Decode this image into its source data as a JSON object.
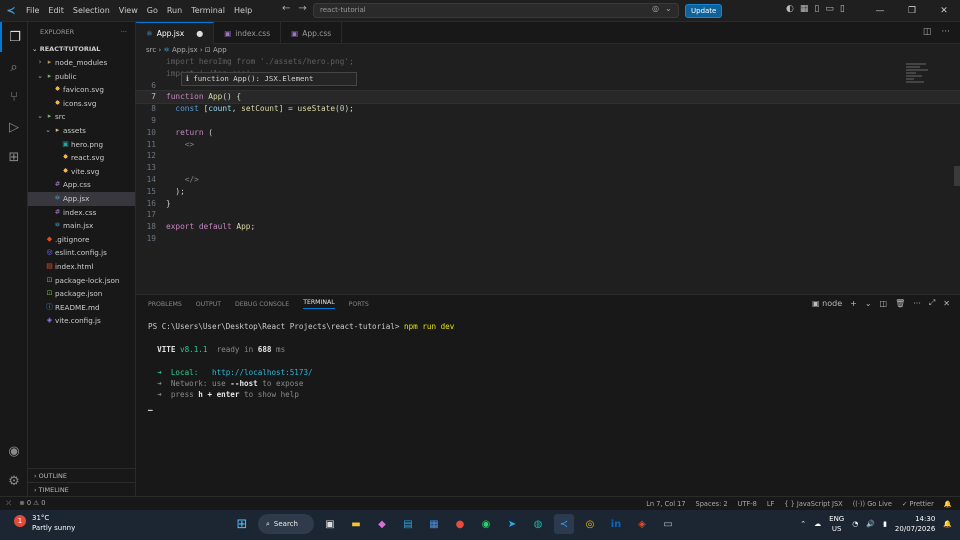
{
  "menu": [
    "File",
    "Edit",
    "Selection",
    "View",
    "Go",
    "Run",
    "Terminal",
    "Help"
  ],
  "search": {
    "text": "react-tutorial"
  },
  "update_label": "Update",
  "sidebar": {
    "header": "EXPLORER",
    "project": "REACT-TUTORIAL",
    "items": [
      {
        "label": "node_modules",
        "indent": 1,
        "chev": ">",
        "icon": "folder",
        "color": "#c09553"
      },
      {
        "label": "public",
        "indent": 1,
        "chev": "v",
        "icon": "folder",
        "color": "#7eb36a"
      },
      {
        "label": "favicon.svg",
        "indent": 2,
        "icon": "svg",
        "color": "#ffb13b"
      },
      {
        "label": "icons.svg",
        "indent": 2,
        "icon": "svg",
        "color": "#ffb13b"
      },
      {
        "label": "src",
        "indent": 1,
        "chev": "v",
        "icon": "folder",
        "color": "#7eb36a"
      },
      {
        "label": "assets",
        "indent": 2,
        "chev": "v",
        "icon": "folder",
        "color": "#dcb67a"
      },
      {
        "label": "hero.png",
        "indent": 3,
        "icon": "png",
        "color": "#26a69a"
      },
      {
        "label": "react.svg",
        "indent": 3,
        "icon": "svg",
        "color": "#ffb13b"
      },
      {
        "label": "vite.svg",
        "indent": 3,
        "icon": "svg",
        "color": "#ffb13b"
      },
      {
        "label": "App.css",
        "indent": 2,
        "icon": "css",
        "color": "#a074c4"
      },
      {
        "label": "App.jsx",
        "indent": 2,
        "icon": "react",
        "color": "#4fc1ff",
        "selected": true
      },
      {
        "label": "index.css",
        "indent": 2,
        "icon": "css",
        "color": "#a074c4"
      },
      {
        "label": "main.jsx",
        "indent": 2,
        "icon": "react",
        "color": "#4fc1ff"
      },
      {
        "label": ".gitignore",
        "indent": 1,
        "icon": "git",
        "color": "#e64a19"
      },
      {
        "label": "eslint.config.js",
        "indent": 1,
        "icon": "eslint",
        "color": "#7c6ff0"
      },
      {
        "label": "index.html",
        "indent": 1,
        "icon": "html",
        "color": "#e44d26"
      },
      {
        "label": "package-lock.json",
        "indent": 1,
        "icon": "npm",
        "color": "#7cb342"
      },
      {
        "label": "package.json",
        "indent": 1,
        "icon": "npm",
        "color": "#7cb342"
      },
      {
        "label": "README.md",
        "indent": 1,
        "icon": "md",
        "color": "#42a5f5"
      },
      {
        "label": "vite.config.js",
        "indent": 1,
        "icon": "vite",
        "color": "#9c7cf7"
      }
    ],
    "outline": "OUTLINE",
    "timeline": "TIMELINE"
  },
  "tabs": [
    {
      "label": "App.jsx",
      "icon_color": "#4fc1ff",
      "active": true,
      "modified": true
    },
    {
      "label": "index.css",
      "icon_color": "#a074c4"
    },
    {
      "label": "App.css",
      "icon_color": "#a074c4"
    }
  ],
  "breadcrumb": {
    "a": "src",
    "b": "App.jsx",
    "c": "App"
  },
  "hover_text": "function App(): JSX.Element",
  "code_lines": [
    {
      "n": "",
      "t": [
        [
          "plain",
          "import heroImg from './assets/hero.png';"
        ]
      ],
      "faded": true
    },
    {
      "n": "",
      "t": [
        [
          "plain",
          "import './App.css'"
        ]
      ],
      "faded": true
    },
    {
      "n": "6",
      "t": []
    },
    {
      "n": "7",
      "t": [
        [
          "kw",
          "function "
        ],
        [
          "fn",
          "App"
        ],
        [
          "plain",
          "() {"
        ]
      ],
      "current": true
    },
    {
      "n": "8",
      "t": [
        [
          "plain",
          "  "
        ],
        [
          "blue",
          "const "
        ],
        [
          "plain",
          "["
        ],
        [
          "var",
          "count"
        ],
        [
          "plain",
          ", "
        ],
        [
          "fn",
          "setCount"
        ],
        [
          "plain",
          "] = "
        ],
        [
          "fn",
          "useState"
        ],
        [
          "plain",
          "("
        ],
        [
          "num",
          "0"
        ],
        [
          "plain",
          ");"
        ]
      ]
    },
    {
      "n": "9",
      "t": []
    },
    {
      "n": "10",
      "t": [
        [
          "plain",
          "  "
        ],
        [
          "kw",
          "return "
        ],
        [
          "plain",
          "("
        ]
      ]
    },
    {
      "n": "11",
      "t": [
        [
          "plain",
          "    "
        ],
        [
          "dim",
          "<>"
        ]
      ]
    },
    {
      "n": "12",
      "t": []
    },
    {
      "n": "13",
      "t": []
    },
    {
      "n": "14",
      "t": [
        [
          "plain",
          "    "
        ],
        [
          "dim",
          "</>"
        ]
      ]
    },
    {
      "n": "15",
      "t": [
        [
          "plain",
          "  );"
        ]
      ]
    },
    {
      "n": "16",
      "t": [
        [
          "plain",
          "}"
        ]
      ]
    },
    {
      "n": "17",
      "t": []
    },
    {
      "n": "18",
      "t": [
        [
          "kw",
          "export default "
        ],
        [
          "fn",
          "App"
        ],
        [
          "plain",
          ";"
        ]
      ]
    },
    {
      "n": "19",
      "t": []
    }
  ],
  "panel": {
    "tabs": [
      "PROBLEMS",
      "OUTPUT",
      "DEBUG CONSOLE",
      "TERMINAL",
      "PORTS"
    ],
    "active": 3,
    "shell": "node"
  },
  "terminal": {
    "prompt": "PS C:\\Users\\User\\Desktop\\React Projects\\react-tutorial> ",
    "cmd": "npm run dev",
    "vite_name": "VITE",
    "vite_ver": " v8.1.1",
    "ready": "  ready in ",
    "ready_ms": "688",
    "ready_unit": " ms",
    "local_label": "  ➜  Local:   ",
    "local_url": "http://localhost:5173/",
    "net_label": "  ➜  Network: use ",
    "net_host": "--host",
    "net_tail": " to expose",
    "help_prefix": "  ➜  press ",
    "help_h": "h + enter",
    "help_tail": " to show help"
  },
  "status": {
    "errors": "⊗ 0 ⚠ 0",
    "position": "Ln 7, Col 17",
    "spaces": "Spaces: 2",
    "encoding": "UTF-8",
    "eol": "LF",
    "lang": "{ } JavaScript JSX",
    "golive": "Go Live",
    "prettier": "✓ Prettier"
  },
  "taskbar": {
    "weather_temp": "31°C",
    "weather_desc": "Partly sunny",
    "search": "Search",
    "lang_top": "ENG",
    "lang_bottom": "US",
    "time": "14:30",
    "date": "20/07/2026"
  }
}
